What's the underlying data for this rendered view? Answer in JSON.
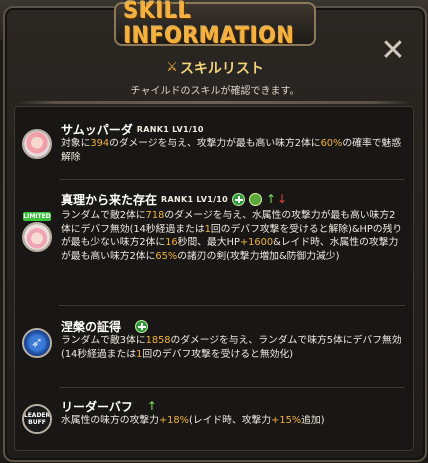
{
  "title": "SKILL INFORMATION",
  "close_label": "✕",
  "header": {
    "title": "スキルリスト",
    "subtitle": "チャイルドのスキルが確認できます。"
  },
  "skills": [
    {
      "name": "サムッパーダ",
      "rank": "RANK1 LV1/10",
      "avatar": "character-portrait-icon",
      "desc_parts": [
        {
          "t": "対象に"
        },
        {
          "t": "394",
          "h": 1
        },
        {
          "t": "のダメージを与え、攻撃力が最も高い味方2体に"
        },
        {
          "t": "60%",
          "h": 1
        },
        {
          "t": "の確率で魅惑解除"
        }
      ]
    },
    {
      "name": "真理から来た存在",
      "rank": "RANK1 LV1/10",
      "badge": "LIMITED",
      "avatar": "character-portrait-icon",
      "icons": [
        "heal-icon",
        "cleanse-icon",
        "stat-up-icon",
        "stat-down-icon"
      ],
      "desc_parts": [
        {
          "t": "ランダムで敵2体に"
        },
        {
          "t": "718",
          "h": 1
        },
        {
          "t": "のダメージを与え、水属性の攻撃力が最も高い味方2体にデバフ無効(14秒経過または"
        },
        {
          "t": "1",
          "h": 1
        },
        {
          "t": "回のデバフ攻撃を受けると解除)&HPの残りが最も少ない味方2体に"
        },
        {
          "t": "16",
          "h": 1
        },
        {
          "t": "秒間、最大HP"
        },
        {
          "t": "+1600",
          "h": 1
        },
        {
          "t": "&レイド時、水属性の攻撃力が最も高い味方2体に"
        },
        {
          "t": "65%",
          "h": 1
        },
        {
          "t": "の諸刃の剣(攻撃力増加&防御力減少)"
        }
      ]
    },
    {
      "name": "涅槃の証得",
      "avatar": "wing-icon",
      "icons": [
        "heal-icon"
      ],
      "desc_parts": [
        {
          "t": "ランダムで敵3体に"
        },
        {
          "t": "1858",
          "h": 1
        },
        {
          "t": "のダメージを与え、ランダムで味方5体にデバフ無効(14秒経過または"
        },
        {
          "t": "1",
          "h": 1
        },
        {
          "t": "回のデバフ攻撃を受けると無効化)"
        }
      ]
    },
    {
      "name": "リーダーバフ",
      "avatar": "leader-buff-icon",
      "avatar_text": [
        "LEADER",
        "BUFF"
      ],
      "icons": [
        "stat-up-icon"
      ],
      "desc_parts": [
        {
          "t": "水属性の味方の攻撃力"
        },
        {
          "t": "+18%",
          "h": 1
        },
        {
          "t": "(レイド時、攻撃力"
        },
        {
          "t": "+15%",
          "h": 1
        },
        {
          "t": "追加)"
        }
      ]
    }
  ],
  "colors": {
    "title": "#f6b23c",
    "highlight": "#f2b23c",
    "text": "#eeeae2"
  }
}
